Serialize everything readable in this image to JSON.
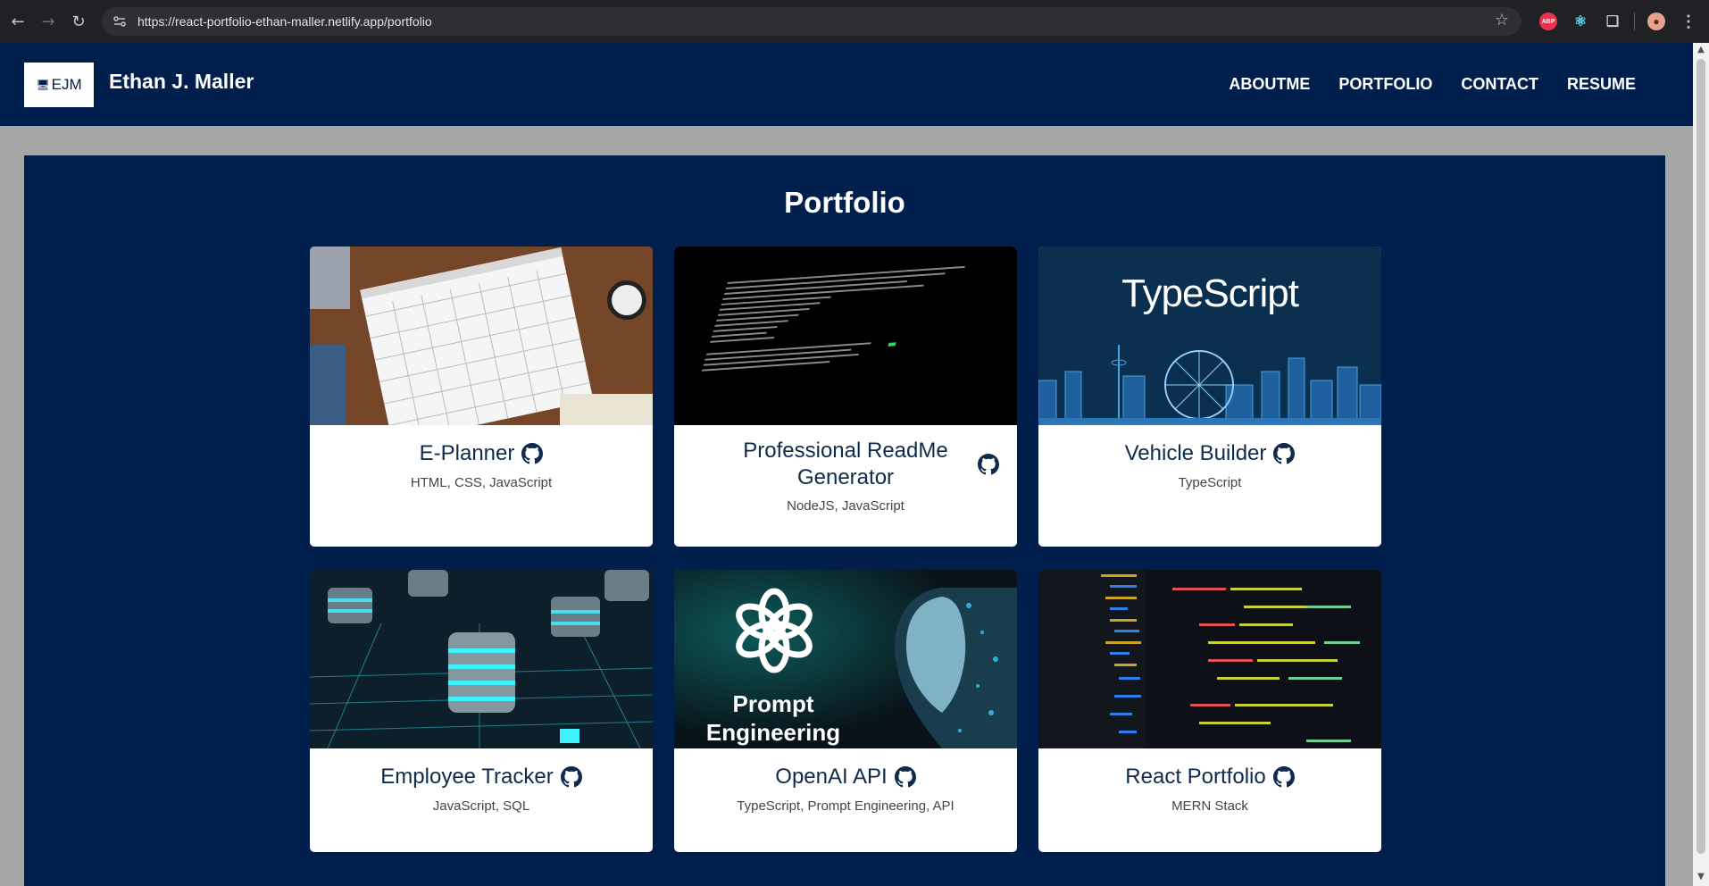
{
  "browser": {
    "url": "https://react-portfolio-ethan-maller.netlify.app/portfolio",
    "extensions": {
      "abp": "ABP"
    }
  },
  "header": {
    "logo_text": "EJM",
    "name": "Ethan J. Maller",
    "nav": [
      "ABOUTME",
      "PORTFOLIO",
      "CONTACT",
      "RESUME"
    ]
  },
  "main": {
    "title": "Portfolio",
    "projects": [
      {
        "title": "E-Planner",
        "tech": "HTML, CSS, JavaScript",
        "image": "calendar-photo"
      },
      {
        "title": "Professional ReadMe Generator",
        "tech": "NodeJS, JavaScript",
        "image": "terminal-screenshot"
      },
      {
        "title": "Vehicle Builder",
        "tech": "TypeScript",
        "image": "typescript-skyline"
      },
      {
        "title": "Employee Tracker",
        "tech": "JavaScript, SQL",
        "image": "database-servers"
      },
      {
        "title": "OpenAI API",
        "tech": "TypeScript, Prompt Engineering, API",
        "image": "prompt-engineering-art",
        "image_text": [
          "Prompt",
          "Engineering"
        ]
      },
      {
        "title": "React Portfolio",
        "tech": "MERN Stack",
        "image": "code-editor-screenshot"
      }
    ],
    "typescript_banner": "TypeScript"
  },
  "colors": {
    "navy": "#001f4d",
    "page_bg": "#a6a6a6",
    "card_title": "#102a4c"
  }
}
